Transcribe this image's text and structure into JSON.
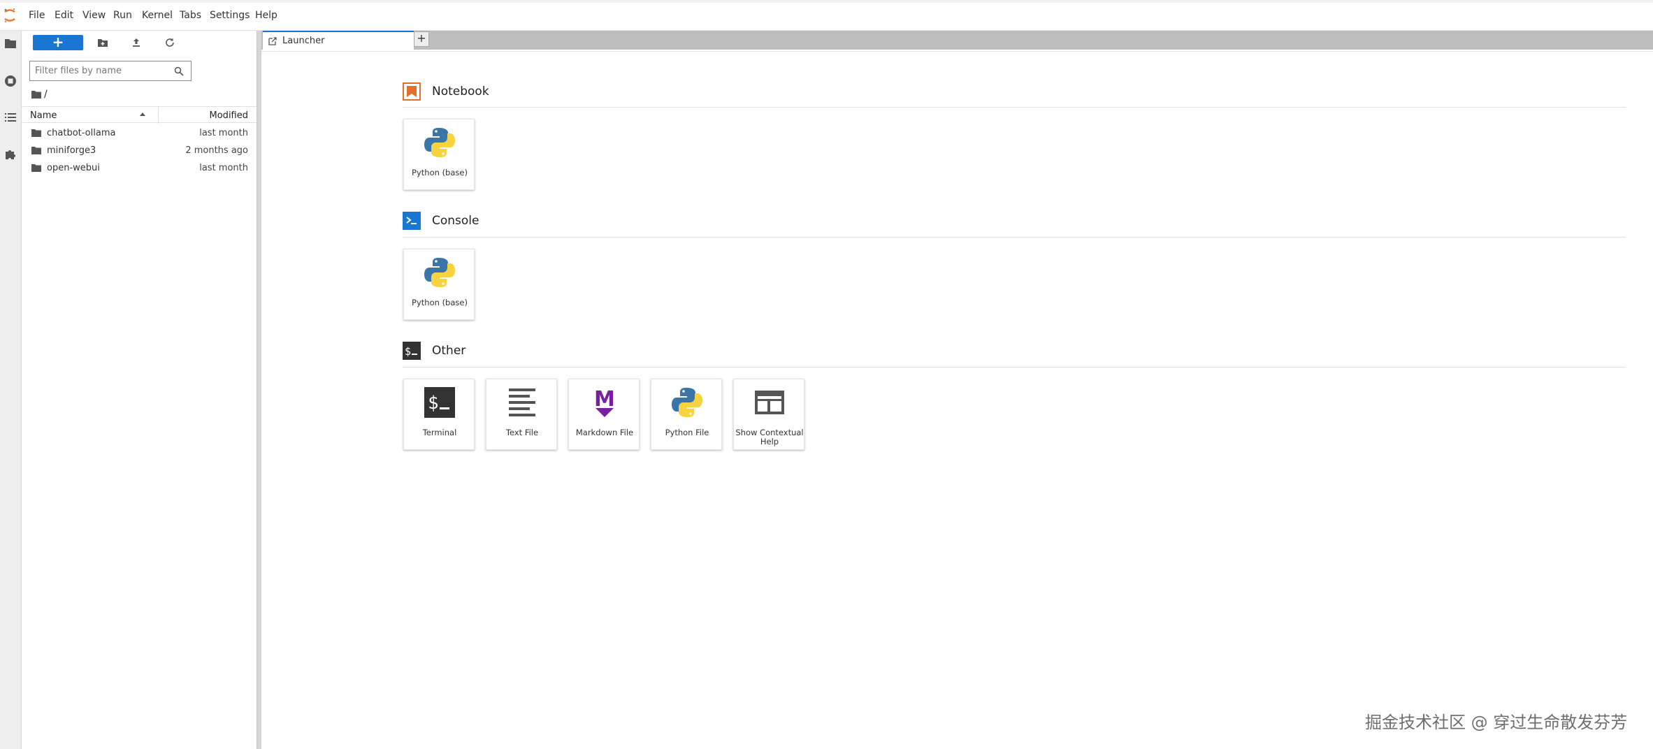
{
  "menubar": {
    "items": [
      "File",
      "Edit",
      "View",
      "Run",
      "Kernel",
      "Tabs",
      "Settings",
      "Help"
    ]
  },
  "activitybar": {
    "icons": [
      "folder-icon",
      "running-icon",
      "toc-icon",
      "extension-icon"
    ]
  },
  "filebrowser": {
    "new_label": "+",
    "filter_placeholder": "Filter files by name",
    "breadcrumb": "/",
    "columns": {
      "name": "Name",
      "modified": "Modified"
    },
    "rows": [
      {
        "name": "chatbot-ollama",
        "modified": "last month"
      },
      {
        "name": "miniforge3",
        "modified": "2 months ago"
      },
      {
        "name": "open-webui",
        "modified": "last month"
      }
    ]
  },
  "tabs": {
    "active_label": "Launcher",
    "add_label": "+"
  },
  "launcher": {
    "sections": [
      {
        "title": "Notebook",
        "cards": [
          "Python (base)"
        ]
      },
      {
        "title": "Console",
        "cards": [
          "Python (base)"
        ]
      },
      {
        "title": "Other",
        "cards": [
          "Terminal",
          "Text File",
          "Markdown File",
          "Python File",
          "Show Contextual Help"
        ]
      }
    ]
  },
  "colors": {
    "accent": "#1976d2",
    "notebook_orange": "#e46e2e",
    "console_blue": "#1976d2",
    "markdown_purple": "#7b1fa2",
    "python_blue": "#3a75a8",
    "python_yellow": "#f7d341"
  },
  "watermark": "掘金技术社区 @ 穿过生命散发芬芳"
}
